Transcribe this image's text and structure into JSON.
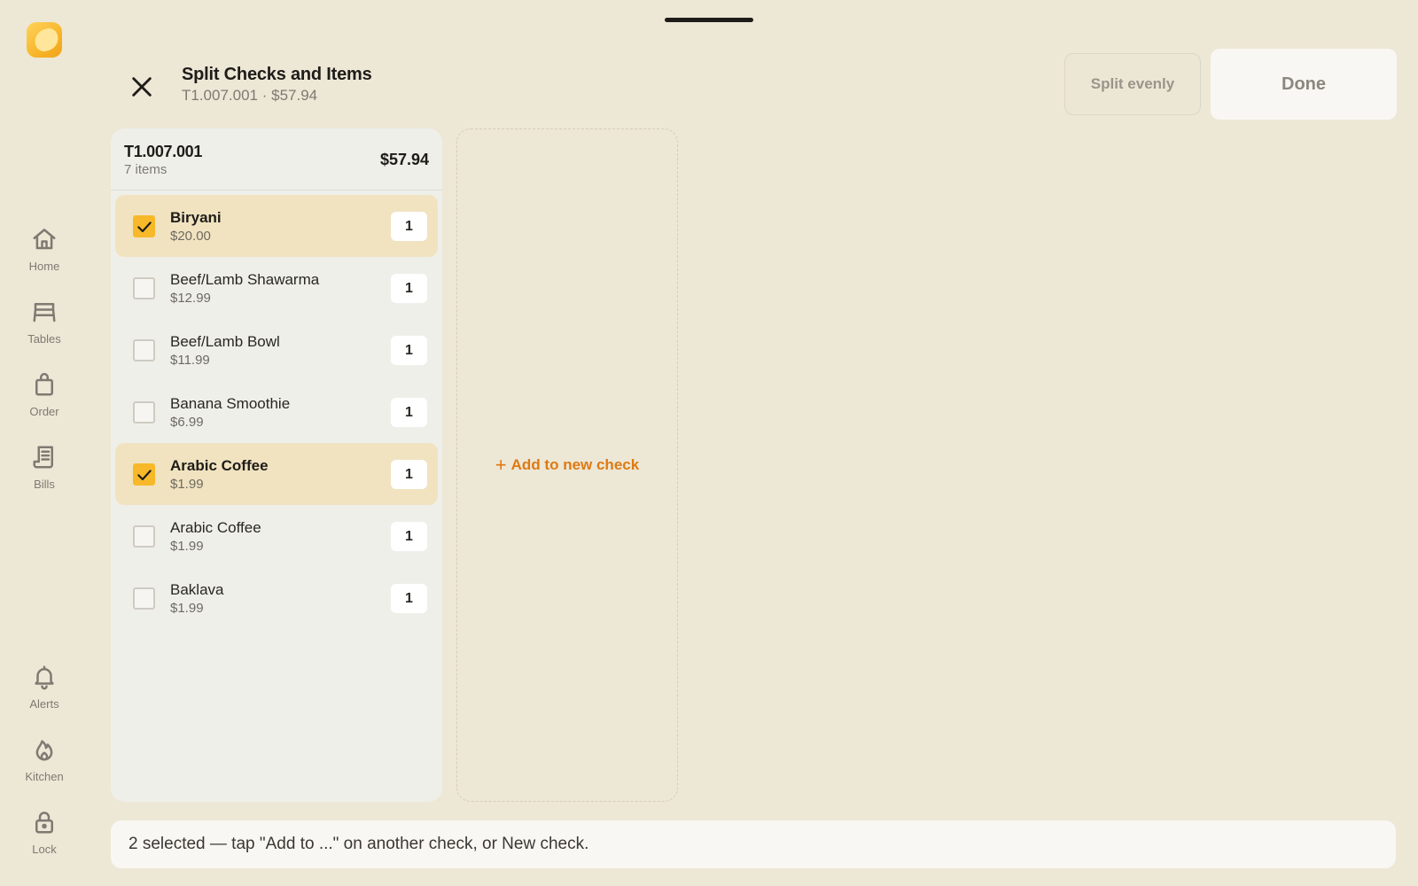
{
  "sidebar": {
    "nav_top": [
      {
        "label": "Home",
        "icon": "home-icon"
      },
      {
        "label": "Tables",
        "icon": "table-icon"
      },
      {
        "label": "Order",
        "icon": "shopping-bag-icon"
      },
      {
        "label": "Bills",
        "icon": "receipt-icon"
      }
    ],
    "nav_bottom": [
      {
        "label": "Alerts",
        "icon": "bell-icon"
      },
      {
        "label": "Kitchen",
        "icon": "flame-icon"
      },
      {
        "label": "Lock",
        "icon": "lock-icon"
      }
    ]
  },
  "header": {
    "title": "Split Checks and Items",
    "subtitle": "T1.007.001 · $57.94",
    "split_evenly_label": "Split evenly",
    "done_label": "Done"
  },
  "check": {
    "id": "T1.007.001",
    "item_count": "7 items",
    "total": "$57.94",
    "items": [
      {
        "name": "Biryani",
        "price": "$20.00",
        "qty": "1",
        "selected": true
      },
      {
        "name": "Beef/Lamb Shawarma",
        "price": "$12.99",
        "qty": "1",
        "selected": false
      },
      {
        "name": "Beef/Lamb Bowl",
        "price": "$11.99",
        "qty": "1",
        "selected": false
      },
      {
        "name": "Banana Smoothie",
        "price": "$6.99",
        "qty": "1",
        "selected": false
      },
      {
        "name": "Arabic Coffee",
        "price": "$1.99",
        "qty": "1",
        "selected": true
      },
      {
        "name": "Arabic Coffee",
        "price": "$1.99",
        "qty": "1",
        "selected": false
      },
      {
        "name": "Baklava",
        "price": "$1.99",
        "qty": "1",
        "selected": false
      }
    ]
  },
  "new_check": {
    "label": "Add to new check"
  },
  "status": {
    "text": "2 selected — tap \"Add to ...\" on another check, or New check."
  },
  "colors": {
    "background": "#ede7d6",
    "accent": "#f7b92a",
    "selected_row": "#f1e3c0",
    "link_orange": "#de7a12"
  }
}
